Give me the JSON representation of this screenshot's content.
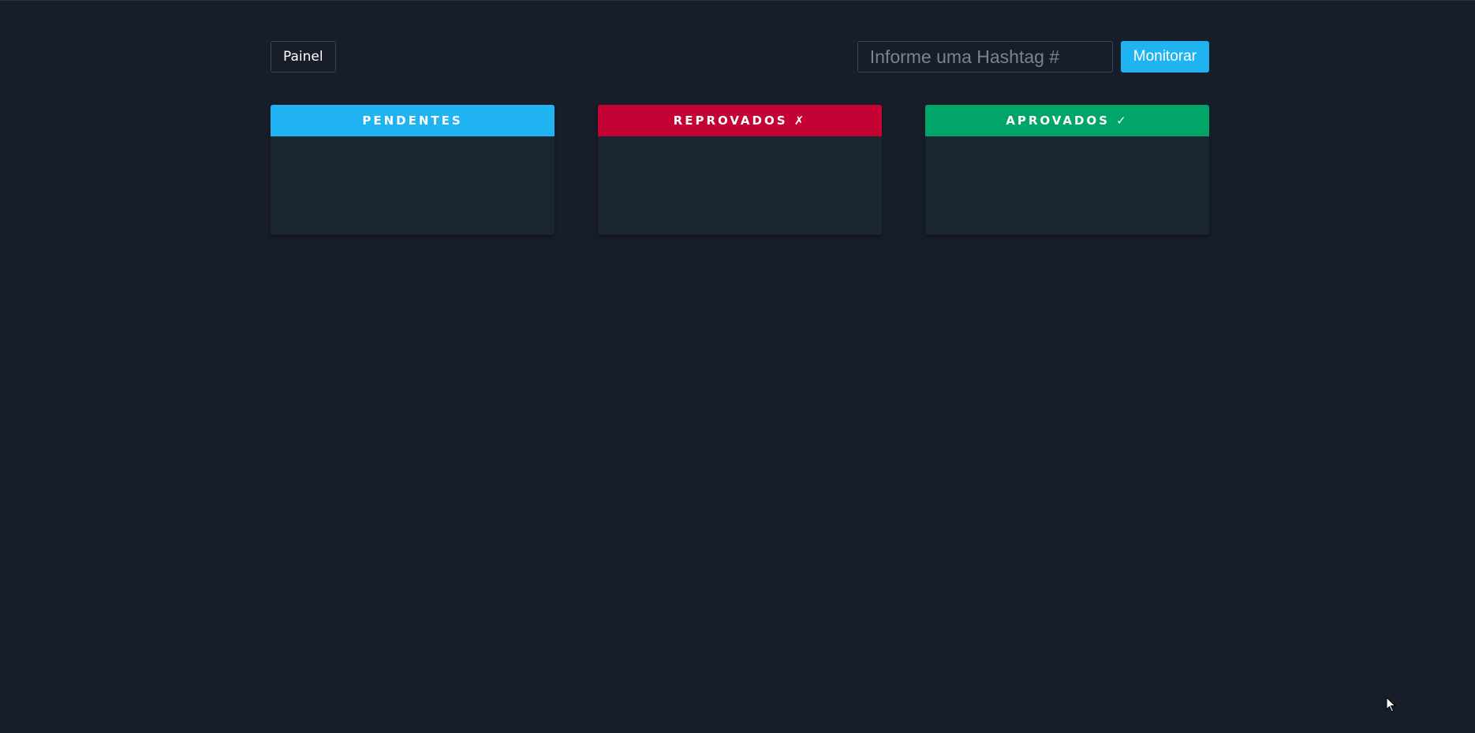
{
  "toolbar": {
    "painel_label": "Painel",
    "hashtag_placeholder": "Informe uma Hashtag #",
    "hashtag_value": "",
    "monitor_label": "Monitorar",
    "monitor_color": "#1fb4f1"
  },
  "columns": [
    {
      "title": "PENDENTES",
      "color": "#1fb4f1",
      "items": []
    },
    {
      "title": "REPROVADOS ✗",
      "color": "#c40233",
      "items": []
    },
    {
      "title": "APROVADOS ✓",
      "color": "#00a567",
      "items": []
    }
  ]
}
